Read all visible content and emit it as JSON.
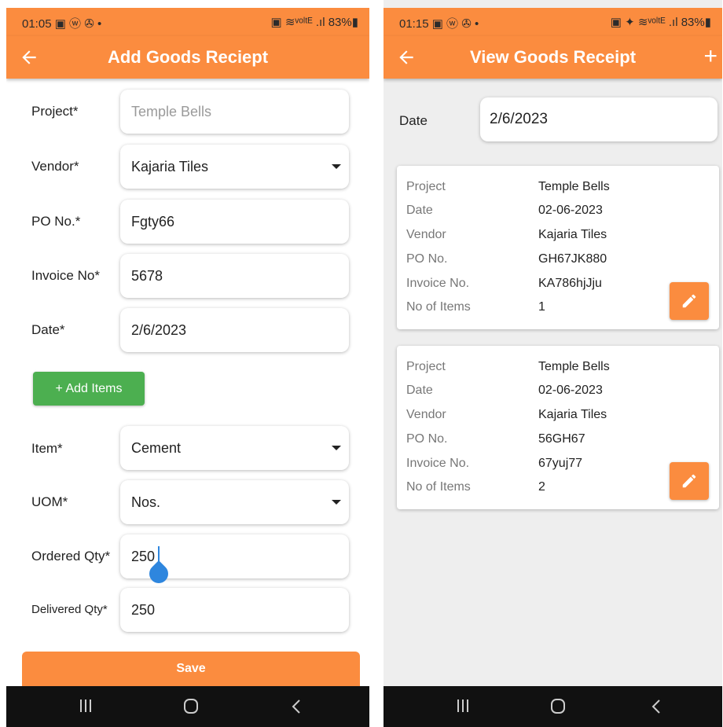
{
  "left": {
    "status": {
      "time": "01:05",
      "icons": "▣ ⓦ ✇ •",
      "right": "▣ ≋ᵛᵒˡᵗᴱ .ıl 83%▮"
    },
    "title": "Add Goods Reciept",
    "fields": [
      {
        "label": "Project*",
        "value": "Temple Bells",
        "placeholder": true
      },
      {
        "label": "Vendor*",
        "value": "Kajaria Tiles",
        "dropdown": true
      },
      {
        "label": "PO No.*",
        "value": "Fgty66"
      },
      {
        "label": "Invoice No*",
        "value": "5678"
      },
      {
        "label": "Date*",
        "value": "2/6/2023"
      }
    ],
    "add_items_label": "+ Add Items",
    "item_fields": [
      {
        "label": "Item*",
        "value": "Cement",
        "dropdown": true
      },
      {
        "label": "UOM*",
        "value": "Nos.",
        "dropdown": true
      },
      {
        "label": "Ordered Qty*",
        "value": "250"
      },
      {
        "label": "Delivered Qty*",
        "value": "250"
      }
    ],
    "save_label": "Save"
  },
  "right": {
    "status": {
      "time": "01:15",
      "icons": "▣ ⓦ ✇ •",
      "right": "▣ ✦ ≋ᵛᵒˡᵗᴱ .ıl 83%▮"
    },
    "title": "View Goods Receipt",
    "date_label": "Date",
    "date_value": "2/6/2023",
    "cards": [
      {
        "rows": [
          {
            "k": "Project",
            "v": "Temple Bells"
          },
          {
            "k": "Date",
            "v": "02-06-2023"
          },
          {
            "k": "Vendor",
            "v": "Kajaria Tiles"
          },
          {
            "k": "PO No.",
            "v": "GH67JK880"
          },
          {
            "k": "Invoice No.",
            "v": "KA786hjJju"
          },
          {
            "k": "No of Items",
            "v": "1"
          }
        ]
      },
      {
        "rows": [
          {
            "k": "Project",
            "v": "Temple Bells"
          },
          {
            "k": "Date",
            "v": "02-06-2023"
          },
          {
            "k": "Vendor",
            "v": "Kajaria Tiles"
          },
          {
            "k": "PO No.",
            "v": "56GH67"
          },
          {
            "k": "Invoice No.",
            "v": "67yuj77"
          },
          {
            "k": "No of Items",
            "v": "2"
          }
        ]
      }
    ]
  },
  "colors": {
    "accent": "#fb8c3f",
    "green": "#4caf50",
    "cursor": "#2e86de"
  },
  "icons": [
    "back-arrow-icon",
    "add-icon",
    "dropdown-caret-icon",
    "edit-pencil-icon",
    "nav-recents-icon",
    "nav-home-icon",
    "nav-back-icon"
  ]
}
